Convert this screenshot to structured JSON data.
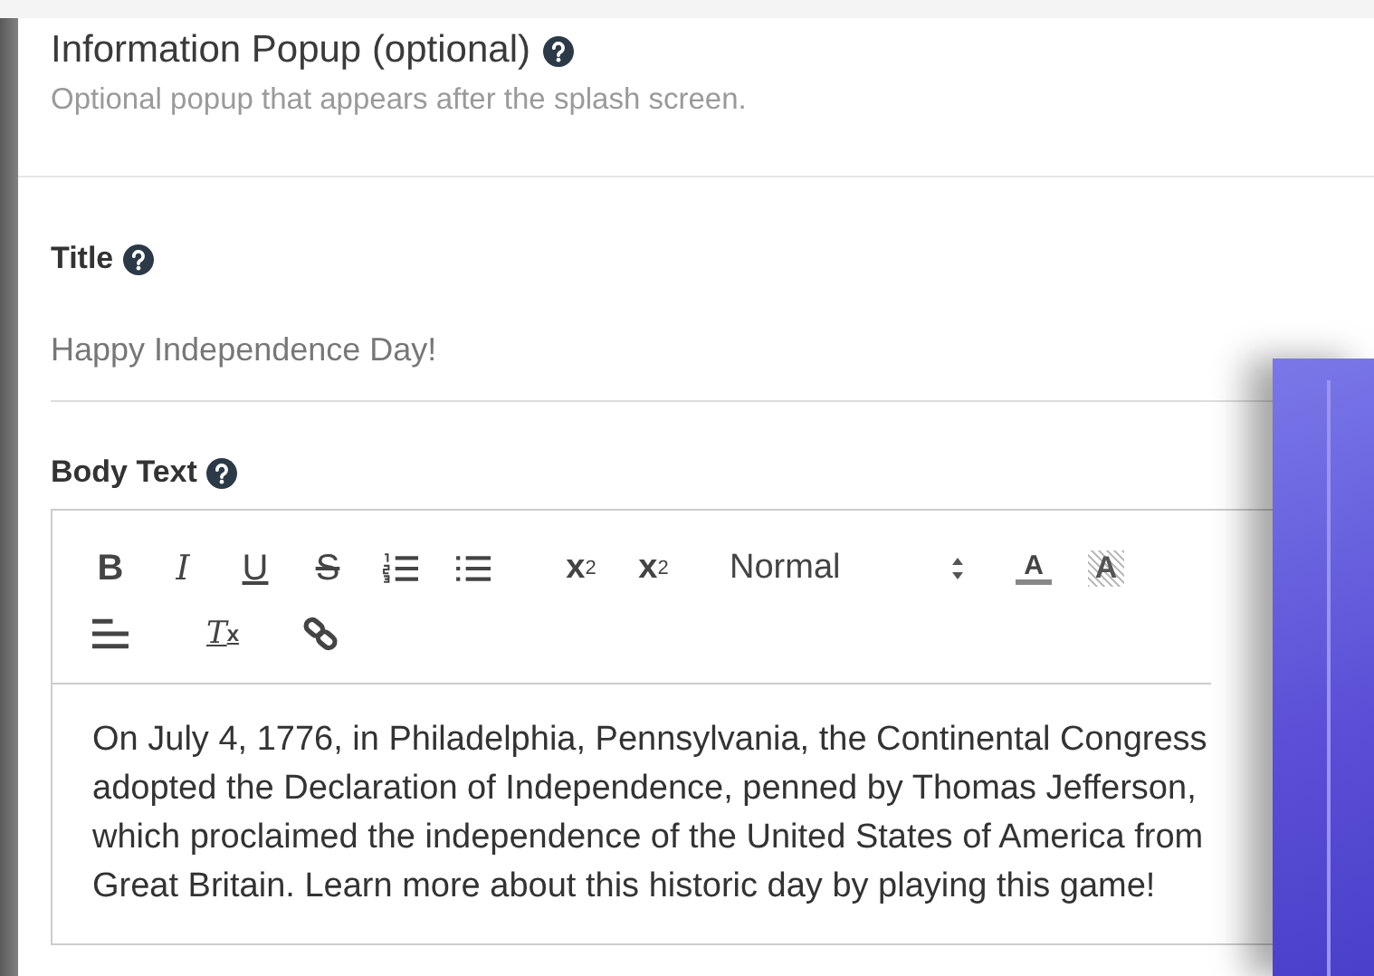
{
  "section": {
    "title": "Information Popup (optional)",
    "description": "Optional popup that appears after the splash screen."
  },
  "title_field": {
    "label": "Title",
    "value": "Happy Independence Day!"
  },
  "body_field": {
    "label": "Body Text",
    "toolbar": [
      {
        "kind": "bold",
        "label": "B"
      },
      {
        "kind": "italic",
        "label": "I"
      },
      {
        "kind": "underline",
        "label": "U"
      },
      {
        "kind": "strike",
        "label": "S"
      },
      {
        "kind": "ordered-list"
      },
      {
        "kind": "bullet-list"
      },
      {
        "kind": "subscript",
        "label": "x",
        "index": "2"
      },
      {
        "kind": "superscript",
        "label": "x",
        "index": "2"
      },
      {
        "kind": "select",
        "label": "Normal"
      },
      {
        "kind": "color",
        "label": "A"
      },
      {
        "kind": "background",
        "label": "A"
      },
      {
        "kind": "align"
      },
      {
        "kind": "clean",
        "label": "T",
        "index": "x"
      },
      {
        "kind": "link"
      }
    ],
    "lines": [
      "On July 4, 1776, in Philadelphia, Pennsylvania, the Continental Congress",
      "adopted the Declaration of Independence, penned by Thomas Jefferson,",
      "which proclaimed the independence of the United States of America from",
      "Great Britain. Learn more about this historic day by playing this game!"
    ]
  }
}
